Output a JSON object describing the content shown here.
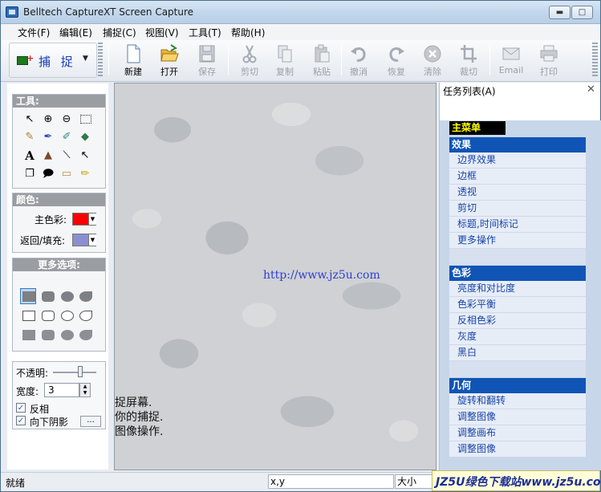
{
  "window": {
    "title": "Belltech CaptureXT Screen Capture"
  },
  "menu": [
    "文件(F)",
    "编辑(E)",
    "捕捉(C)",
    "视图(V)",
    "工具(T)",
    "帮助(H)"
  ],
  "toolbar": {
    "capture_label": "捕 捉",
    "buttons": [
      {
        "label": "新建",
        "icon": "new-file-icon",
        "enabled": true
      },
      {
        "label": "打开",
        "icon": "folder-open-icon",
        "enabled": true
      },
      {
        "label": "保存",
        "icon": "save-icon",
        "enabled": false
      },
      {
        "label": "剪切",
        "icon": "scissors-icon",
        "enabled": false
      },
      {
        "label": "复制",
        "icon": "copy-icon",
        "enabled": false
      },
      {
        "label": "粘贴",
        "icon": "paste-icon",
        "enabled": false
      },
      {
        "label": "撤消",
        "icon": "undo-icon",
        "enabled": false
      },
      {
        "label": "恢复",
        "icon": "redo-icon",
        "enabled": false
      },
      {
        "label": "清除",
        "icon": "clear-icon",
        "enabled": false
      },
      {
        "label": "裁切",
        "icon": "crop-icon",
        "enabled": false
      },
      {
        "label": "Email",
        "icon": "email-icon",
        "enabled": false
      },
      {
        "label": "打印",
        "icon": "printer-icon",
        "enabled": false
      }
    ]
  },
  "left": {
    "tools_title": "工具:",
    "color_title": "颜色:",
    "primary_color_label": "主色彩:",
    "back_fill_label": "返回/填充:",
    "primary_color": "#ff0000",
    "fill_color": "#8a8fd0",
    "more_title": "更多选项:",
    "opacity_label": "不透明:",
    "width_label": "宽度:",
    "width_value": "3",
    "invert_label": "反相",
    "shadow_label": "向下阴影",
    "shadow_button": "..."
  },
  "canvas": {
    "link_text": "http://www.jz5u.com",
    "line1": "捉屏幕.",
    "line2": "你的捕捉.",
    "line3": "图像操作."
  },
  "taskpane": {
    "title": "任务列表(A)",
    "main_menu": "主菜单",
    "groups": [
      {
        "title": "效果",
        "items": [
          "边界效果",
          "边框",
          "透视",
          "剪切",
          "标题,时间标记",
          "更多操作"
        ]
      },
      {
        "title": "色彩",
        "items": [
          "亮度和对比度",
          "色彩平衡",
          "反相色彩",
          "灰度",
          "黑白"
        ]
      },
      {
        "title": "几何",
        "items": [
          "旋转和翻转",
          "调整图像",
          "调整画布",
          "调整图像"
        ]
      }
    ]
  },
  "status": {
    "ready": "就绪",
    "coords": "x,y",
    "size": "大小",
    "brand": "JZ5U绿色下载站www.jz5u.com"
  }
}
